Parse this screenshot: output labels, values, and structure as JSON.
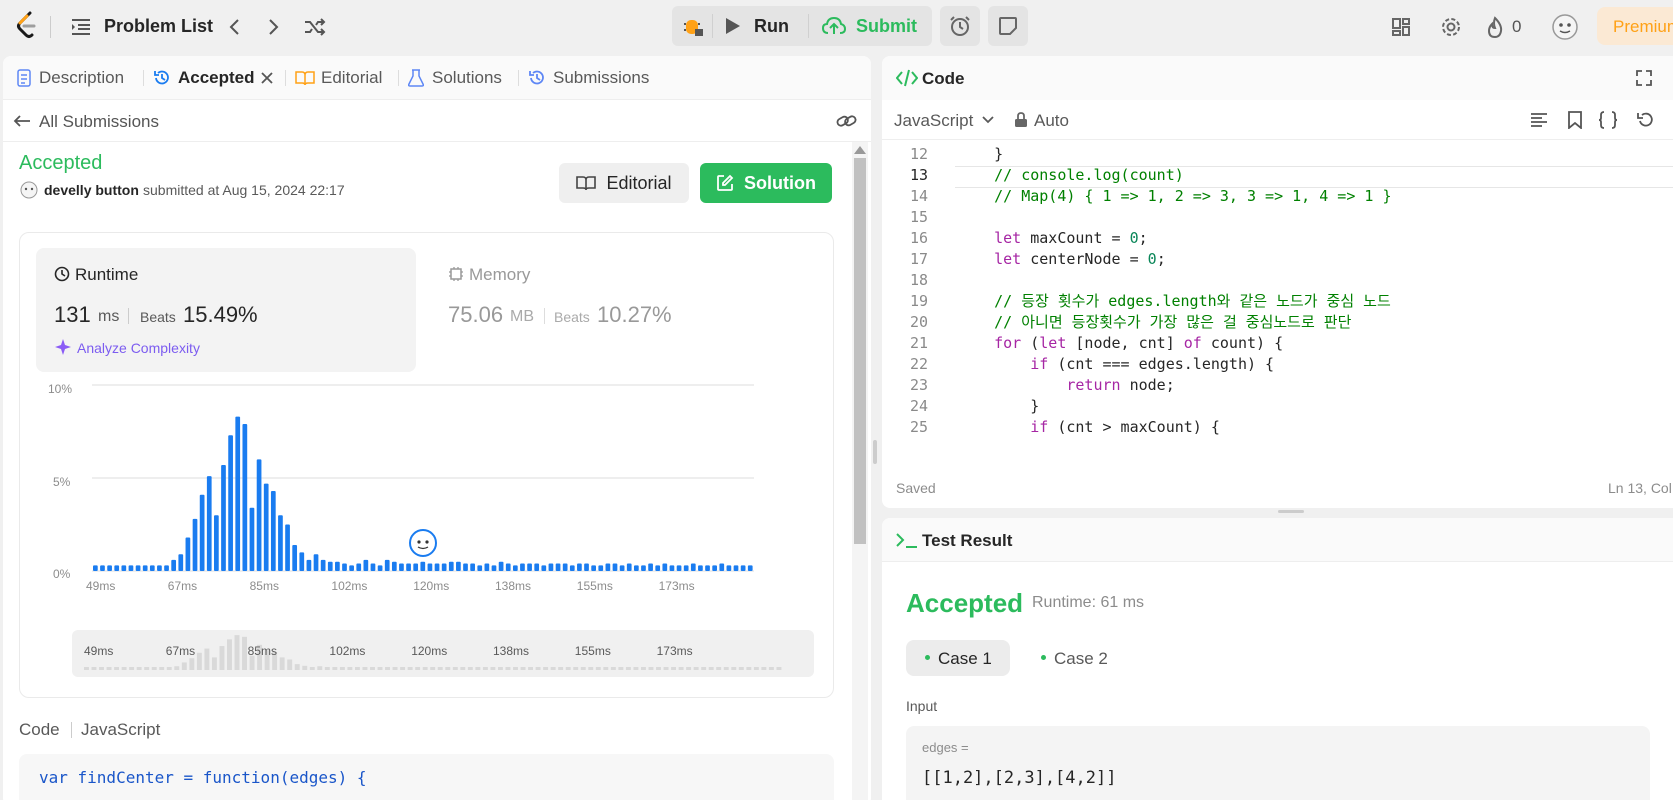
{
  "topbar": {
    "problem_list": "Problem List",
    "run": "Run",
    "submit": "Submit",
    "streak": "0",
    "premium": "Premium"
  },
  "left_tabs": {
    "description": "Description",
    "accepted": "Accepted",
    "editorial": "Editorial",
    "solutions": "Solutions",
    "submissions": "Submissions"
  },
  "submission": {
    "back": "All Submissions",
    "status": "Accepted",
    "user": "develly button",
    "submitted_at": "submitted at Aug 15, 2024 22:17",
    "editorial_btn": "Editorial",
    "solution_btn": "Solution",
    "runtime_label": "Runtime",
    "runtime_value": "131",
    "runtime_unit": "ms",
    "beats": "Beats",
    "runtime_beats": "15.49%",
    "analyze": "Analyze Complexity",
    "memory_label": "Memory",
    "memory_value": "75.06",
    "memory_unit": "MB",
    "memory_beats": "10.27%",
    "code_label": "Code",
    "code_lang": "JavaScript",
    "code_first_line": "var findCenter = function(edges) {"
  },
  "chart_data": {
    "type": "bar",
    "ylabels": [
      "10%",
      "5%",
      "0%"
    ],
    "ylim": [
      0,
      10
    ],
    "xtick_labels": [
      "49ms",
      "67ms",
      "85ms",
      "102ms",
      "120ms",
      "138ms",
      "155ms",
      "173ms"
    ],
    "values": [
      0.3,
      0.3,
      0.3,
      0.3,
      0.3,
      0.3,
      0.3,
      0.3,
      0.3,
      0.3,
      0.3,
      0.6,
      0.9,
      1.8,
      2.8,
      4.1,
      5.1,
      3.0,
      5.7,
      7.3,
      8.3,
      7.9,
      3.4,
      6.0,
      4.7,
      4.3,
      3.0,
      2.5,
      1.4,
      1.0,
      0.6,
      0.9,
      0.6,
      0.5,
      0.5,
      0.4,
      0.3,
      0.4,
      0.6,
      0.4,
      0.3,
      0.6,
      0.5,
      0.4,
      0.4,
      0.4,
      0.5,
      0.4,
      0.4,
      0.4,
      0.5,
      0.5,
      0.4,
      0.4,
      0.3,
      0.4,
      0.3,
      0.5,
      0.4,
      0.3,
      0.4,
      0.4,
      0.4,
      0.3,
      0.4,
      0.4,
      0.4,
      0.3,
      0.4,
      0.4,
      0.3,
      0.3,
      0.4,
      0.4,
      0.3,
      0.4,
      0.3,
      0.3,
      0.4,
      0.3,
      0.4,
      0.3,
      0.3,
      0.3,
      0.4,
      0.3,
      0.3,
      0.3,
      0.4,
      0.3,
      0.3,
      0.3,
      0.3
    ]
  },
  "code_panel": {
    "title": "Code",
    "lang": "JavaScript",
    "auto": "Auto",
    "saved": "Saved",
    "cursor": "Ln 13, Col",
    "lines": [
      {
        "n": "12",
        "t": "    }"
      },
      {
        "n": "13",
        "t": "    // console.log(count)"
      },
      {
        "n": "14",
        "t": "    // Map(4) { 1 => 1, 2 => 3, 3 => 1, 4 => 1 }"
      },
      {
        "n": "15",
        "t": ""
      },
      {
        "n": "16",
        "t": "    let maxCount = 0;"
      },
      {
        "n": "17",
        "t": "    let centerNode = 0;"
      },
      {
        "n": "18",
        "t": ""
      },
      {
        "n": "19",
        "t": "    // 등장 횟수가 edges.length와 같은 노드가 중심 노드"
      },
      {
        "n": "20",
        "t": "    // 아니면 등장횟수가 가장 많은 걸 중심노드로 판단"
      },
      {
        "n": "21",
        "t": "    for (let [node, cnt] of count) {"
      },
      {
        "n": "22",
        "t": "        if (cnt === edges.length) {"
      },
      {
        "n": "23",
        "t": "            return node;"
      },
      {
        "n": "24",
        "t": "        }"
      },
      {
        "n": "25",
        "t": "        if (cnt > maxCount) {"
      }
    ]
  },
  "test_result": {
    "title": "Test Result",
    "status": "Accepted",
    "runtime": "Runtime: 61 ms",
    "case1": "Case 1",
    "case2": "Case 2",
    "input_label": "Input",
    "var_name": "edges =",
    "var_value": "[[1,2],[2,3],[4,2]]"
  }
}
